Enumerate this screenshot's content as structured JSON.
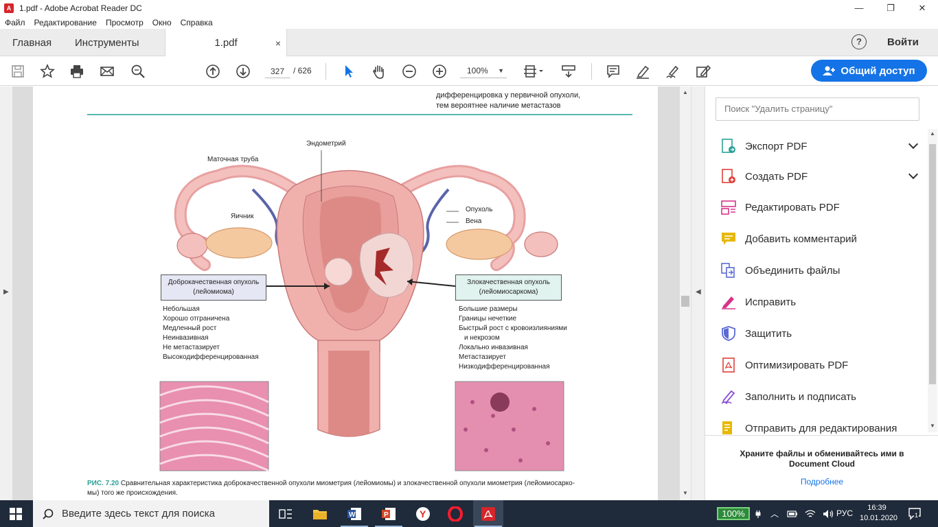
{
  "window": {
    "title": "1.pdf - Adobe Acrobat Reader DC",
    "minimize": "—",
    "maximize": "❐",
    "close": "✕"
  },
  "menu": [
    "Файл",
    "Редактирование",
    "Просмотр",
    "Окно",
    "Справка"
  ],
  "tabs": {
    "home": "Главная",
    "tools": "Инструменты",
    "doc": "1.pdf",
    "doc_close": "×",
    "help": "?",
    "signin": "Войти"
  },
  "toolbar": {
    "page_current": "327",
    "page_total": "/ 626",
    "zoom": "100%",
    "share_label": "Общий доступ"
  },
  "document": {
    "top_text_line1": "дифференцировка у первичной опухоли,",
    "top_text_line2": "тем вероятнее наличие метастазов",
    "label_endometrium": "Эндометрий",
    "label_tube": "Маточная труба",
    "label_ovary": "Яичник",
    "label_tumor": "Опухоль",
    "label_vein": "Вена",
    "benign_box_line1": "Доброкачественная опухоль",
    "benign_box_line2": "(лейомиома)",
    "malignant_box_line1": "Злокачественная опухоль",
    "malignant_box_line2": "(лейомиосаркома)",
    "benign_features": [
      "Небольшая",
      "Хорошо отграничена",
      "Медленный рост",
      "Неинвазивная",
      "Не метастазирует",
      "Высокодифференцированная"
    ],
    "malignant_features": [
      "Большие размеры",
      "Границы нечеткие",
      "Быстрый рост с кровоизлияниями",
      "и некрозом",
      "Локально инвазивная",
      "Метастазирует",
      "Низкодифференцированная"
    ],
    "caption_label": "РИС. 7.20",
    "caption_text": "Сравнительная характеристика доброкачественной опухоли миометрия (лейомиомы) и злокачественной опухоли миометрия (лейомиосарко-",
    "caption_text2": "мы) того же происхождения."
  },
  "pane": {
    "search_placeholder": "Поиск \"Удалить страницу\"",
    "items": [
      {
        "label": "Экспорт PDF",
        "color": "#2aa198",
        "icon": "export-pdf-icon",
        "chevron": true
      },
      {
        "label": "Создать PDF",
        "color": "#e0403a",
        "icon": "create-pdf-icon",
        "chevron": true
      },
      {
        "label": "Редактировать PDF",
        "color": "#d6338a",
        "icon": "edit-pdf-icon",
        "chevron": false
      },
      {
        "label": "Добавить комментарий",
        "color": "#e6b800",
        "icon": "comment-icon",
        "chevron": false
      },
      {
        "label": "Объединить файлы",
        "color": "#5b6ad6",
        "icon": "combine-files-icon",
        "chevron": false
      },
      {
        "label": "Исправить",
        "color": "#d6338a",
        "icon": "redact-icon",
        "chevron": false
      },
      {
        "label": "Защитить",
        "color": "#5b6ad6",
        "icon": "protect-icon",
        "chevron": false
      },
      {
        "label": "Оптимизировать PDF",
        "color": "#e0403a",
        "icon": "optimize-pdf-icon",
        "chevron": false
      },
      {
        "label": "Заполнить и подписать",
        "color": "#8a4fd6",
        "icon": "fill-sign-icon",
        "chevron": false
      },
      {
        "label": "Отправить для редактирования",
        "color": "#e6b800",
        "icon": "send-review-icon",
        "chevron": false
      }
    ],
    "footer_line1": "Храните файлы и обменивайтесь ими в",
    "footer_line2": "Document Cloud",
    "footer_link": "Подробнее"
  },
  "taskbar": {
    "search_placeholder": "Введите здесь текст для поиска",
    "battery": "100%",
    "lang": "РУС",
    "time": "16:39",
    "date": "10.01.2020",
    "notif_count": "1"
  }
}
